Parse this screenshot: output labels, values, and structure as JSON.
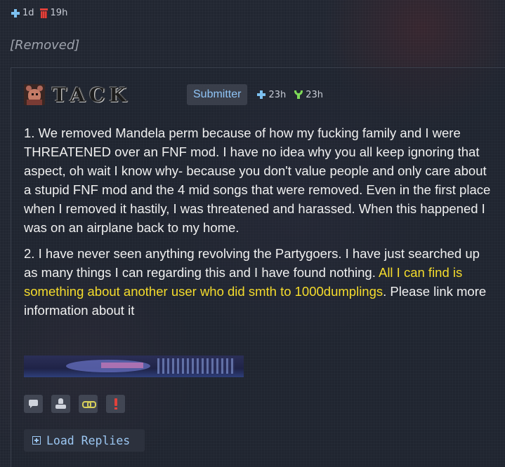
{
  "parent": {
    "upvote_time": "1d",
    "removed_time": "19h",
    "removed_text": "[Removed]"
  },
  "comment": {
    "author_logo_text": "TACK",
    "badge": "Submitter",
    "posted_time": "23h",
    "edited_time": "23h",
    "paragraph1": "1. We removed Mandela perm because of how my fucking family and I were THREATENED over an FNF mod. I have no idea why you all keep ignoring that aspect, oh wait I know why- because you don't value people and only care about a stupid FNF mod and the 4 mid songs that were removed. Even in the first place when I removed it hastily, I was threatened and harassed. When this happened I was on an airplane back to my home.",
    "paragraph2_start": "2. I have never seen anything revolving the Partygoers. I have just searched up as many things I can regarding this and I have found nothing. ",
    "paragraph2_highlight": "All I can find is something about another user who did smth to 1000dumplings",
    "paragraph2_end": ". Please link more information about it"
  },
  "actions": {
    "icons": [
      "reply-icon",
      "stamp-icon",
      "link-icon",
      "report-icon"
    ]
  },
  "load_replies": {
    "label": "Load Replies"
  },
  "colors": {
    "background": "#212631",
    "badge_text": "#8fc4f6",
    "highlight": "#f5dc2c",
    "link": "#9cc7f2",
    "removed": "#9ea3ad"
  }
}
